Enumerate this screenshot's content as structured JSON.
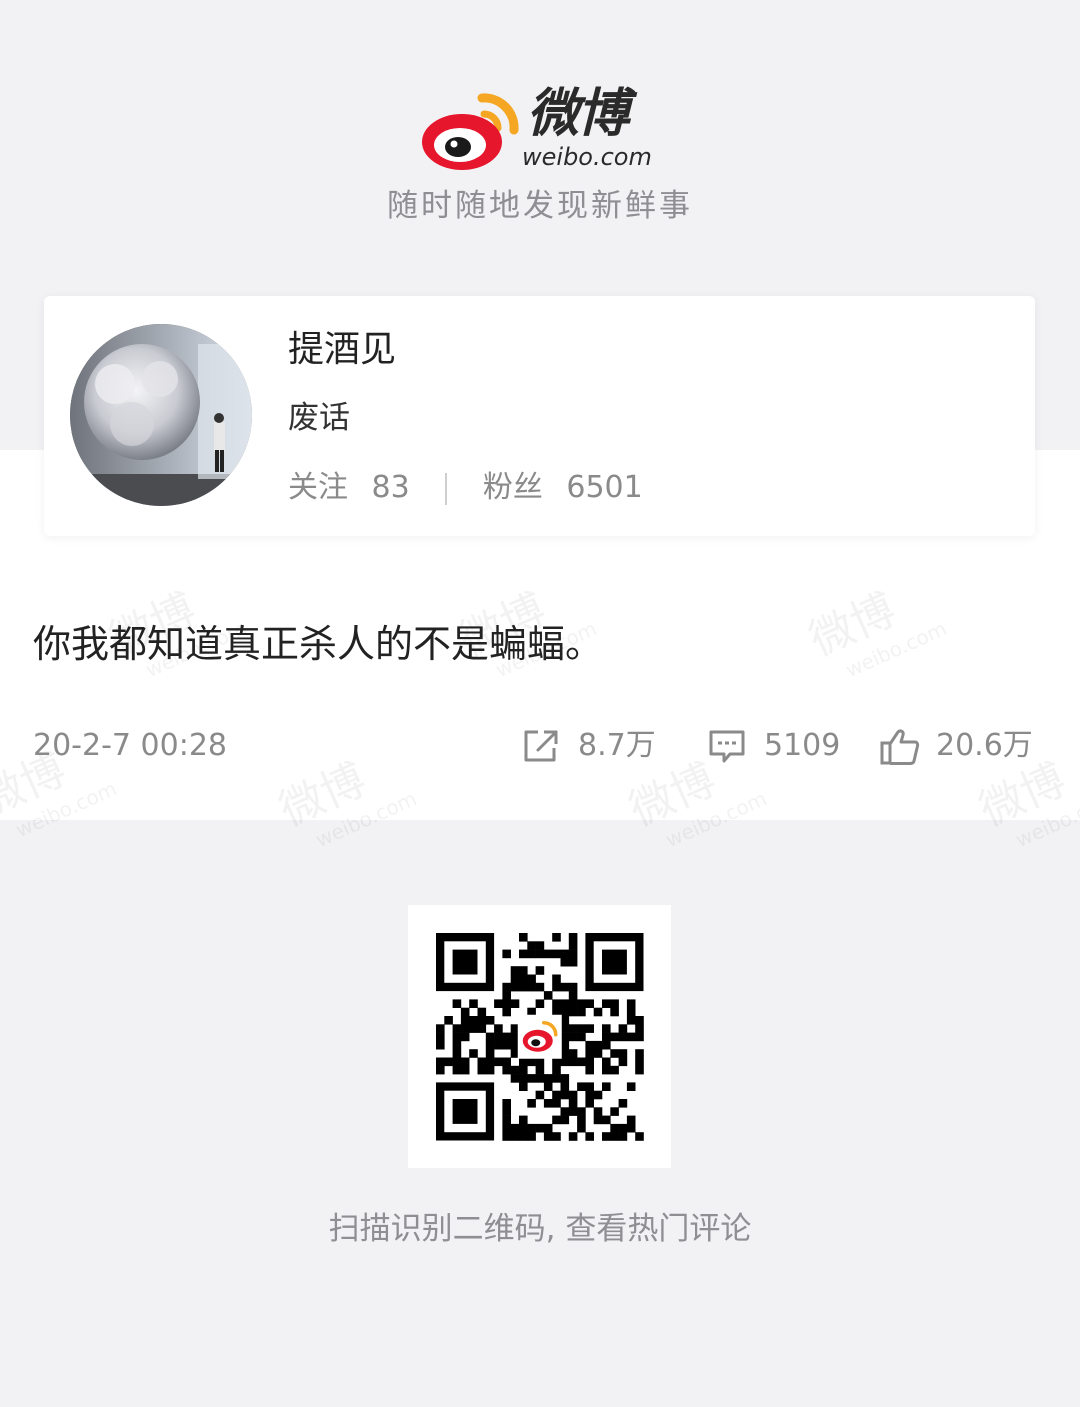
{
  "header": {
    "logo_cn": "微博",
    "logo_en": "weibo.com",
    "slogan": "随时随地发现新鲜事"
  },
  "profile": {
    "username": "提酒见",
    "bio": "废话",
    "following_label": "关注",
    "following_count": "83",
    "followers_label": "粉丝",
    "followers_count": "6501"
  },
  "post": {
    "text": "你我都知道真正杀人的不是蝙蝠。",
    "time": "20-2-7 00:28",
    "reposts": "8.7万",
    "comments": "5109",
    "likes": "20.6万"
  },
  "footer": {
    "qr_caption": "扫描识别二维码, 查看热门评论"
  },
  "icons": {
    "repost": "share-icon",
    "comment": "comment-icon",
    "like": "thumbs-up-icon"
  },
  "colors": {
    "brand_red": "#e6162d",
    "brand_orange": "#f5a623",
    "text_gray": "#8a8a8a",
    "background": "#f2f2f4"
  }
}
